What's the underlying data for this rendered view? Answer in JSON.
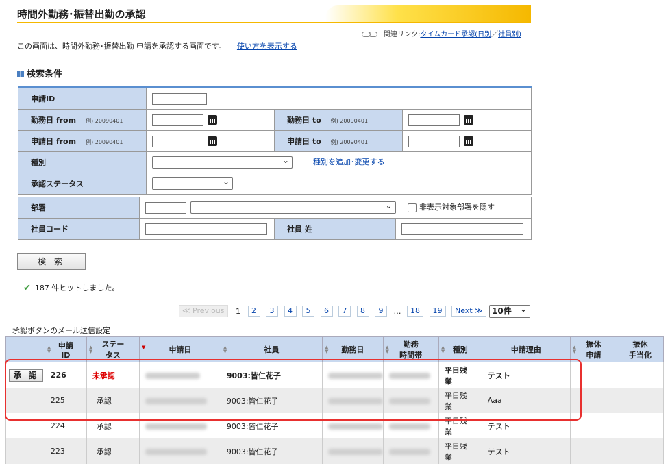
{
  "header": {
    "title": "時間外勤務･振替出勤の承認",
    "related_label": "関連リンク:",
    "related_link1": "タイムカード承認(日別",
    "related_sep": "／",
    "related_link2": "社員別)",
    "description": "この画面は、時間外勤務･振替出勤 申請を承認する画面です。",
    "help_link": "使い方を表示する"
  },
  "search": {
    "heading": "検索条件",
    "request_id": "申請ID",
    "work_from": "勤務日 from",
    "work_to": "勤務日 to",
    "req_from": "申請日 from",
    "req_to": "申請日 to",
    "example": "例) 20090401",
    "type": "種別",
    "type_link": "種別を追加･変更する",
    "status": "承認ステータス",
    "department": "部署",
    "hide_dept": "非表示対象部署を隠す",
    "emp_code": "社員コード",
    "emp_name": "社員 姓",
    "button": "検 索"
  },
  "result": {
    "hits": "187 件ヒットしました。",
    "mail_setting": "承認ボタンのメール送信設定"
  },
  "pager": {
    "prev": "≪ Previous",
    "current": "1",
    "pages": [
      "2",
      "3",
      "4",
      "5",
      "6",
      "7",
      "8",
      "9"
    ],
    "dots": "…",
    "last_pages": [
      "18",
      "19"
    ],
    "next": "Next ≫",
    "per_page": "10件"
  },
  "table": {
    "headers": [
      "申請ID",
      "ステータス",
      "申請日",
      "社員",
      "勤務日",
      "勤務時間帯",
      "種別",
      "申請理由",
      "振休申請",
      "振休手当化"
    ],
    "header_lines": {
      "id": [
        "申請",
        "ID"
      ],
      "status": [
        "ステー",
        "タス"
      ],
      "time": [
        "勤務",
        "時間帯"
      ],
      "comp": [
        "振休",
        "申請"
      ],
      "comp_pay": [
        "振休",
        "手当化"
      ]
    },
    "approve_label": "承 認",
    "rows": [
      {
        "id": "226",
        "status": "未承認",
        "employee": "9003:皆仁花子",
        "type": [
          "平日残",
          "業"
        ],
        "reason": "テスト"
      },
      {
        "id": "225",
        "status": "承認",
        "employee": "9003:皆仁花子",
        "type": [
          "平日残",
          "業"
        ],
        "reason": "Aaa"
      },
      {
        "id": "224",
        "status": "承認",
        "employee": "9003:皆仁花子",
        "type": [
          "平日残",
          "業"
        ],
        "reason": "テスト"
      },
      {
        "id": "223",
        "status": "承認",
        "employee": "9003:皆仁花子",
        "type": [
          "平日残",
          "業"
        ],
        "reason": "テスト"
      }
    ]
  },
  "colors": {
    "accent_yellow": "#f5b800",
    "header_blue": "#c9d9ef",
    "highlight": "#e8302f",
    "pending_red": "#dd0000"
  }
}
